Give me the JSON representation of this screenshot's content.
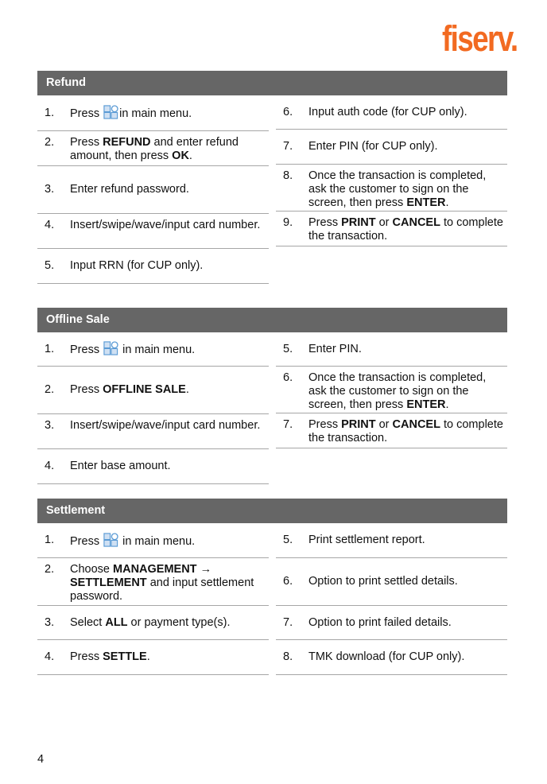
{
  "brand": {
    "logo_text": "fiserv.",
    "color": "#f26a21"
  },
  "header_color": "#666666",
  "sections": {
    "refund": {
      "title": "Refund",
      "left": [
        {
          "n": "1.",
          "parts": [
            [
              "Press ",
              false
            ],
            [
              "[menu-icon]",
              "icon"
            ],
            [
              "in main menu.",
              false
            ]
          ]
        },
        {
          "n": "2.",
          "parts": [
            [
              "Press ",
              false
            ],
            [
              "REFUND",
              true
            ],
            [
              " and enter refund amount, then press ",
              false
            ],
            [
              "OK",
              true
            ],
            [
              ".",
              false
            ]
          ]
        },
        {
          "n": "3.",
          "parts": [
            [
              "Enter refund password.",
              false
            ]
          ]
        },
        {
          "n": "4.",
          "parts": [
            [
              "Insert/swipe/wave/input card number.",
              false
            ]
          ]
        },
        {
          "n": "5.",
          "parts": [
            [
              "Input RRN (for CUP only).",
              false
            ]
          ]
        }
      ],
      "right": [
        {
          "n": "6.",
          "parts": [
            [
              "Input auth code (for CUP only).",
              false
            ]
          ]
        },
        {
          "n": "7.",
          "parts": [
            [
              "Enter PIN (for CUP only).",
              false
            ]
          ]
        },
        {
          "n": "8.",
          "parts": [
            [
              "Once the transaction is completed, ask the customer to sign on the screen, then press ",
              false
            ],
            [
              "ENTER",
              true
            ],
            [
              ".",
              false
            ]
          ]
        },
        {
          "n": "9.",
          "parts": [
            [
              "Press ",
              false
            ],
            [
              "PRINT",
              true
            ],
            [
              " or ",
              false
            ],
            [
              "CANCEL",
              true
            ],
            [
              " to complete the transaction.",
              false
            ]
          ]
        }
      ]
    },
    "offline_sale": {
      "title": "Offline Sale",
      "left": [
        {
          "n": "1.",
          "parts": [
            [
              "Press ",
              false
            ],
            [
              "[menu-icon]",
              "icon"
            ],
            [
              " in main menu.",
              false
            ]
          ]
        },
        {
          "n": "2.",
          "parts": [
            [
              "Press ",
              false
            ],
            [
              "OFFLINE SALE",
              true
            ],
            [
              ".",
              false
            ]
          ]
        },
        {
          "n": "3.",
          "parts": [
            [
              "Insert/swipe/wave/input card number.",
              false
            ]
          ]
        },
        {
          "n": "4.",
          "parts": [
            [
              "Enter base amount.",
              false
            ]
          ]
        }
      ],
      "right": [
        {
          "n": "5.",
          "parts": [
            [
              "Enter PIN.",
              false
            ]
          ]
        },
        {
          "n": "6.",
          "parts": [
            [
              "Once the transaction is completed, ask the customer to sign on the screen, then press ",
              false
            ],
            [
              "ENTER",
              true
            ],
            [
              ".",
              false
            ]
          ]
        },
        {
          "n": "7.",
          "parts": [
            [
              "Press ",
              false
            ],
            [
              "PRINT",
              true
            ],
            [
              " or ",
              false
            ],
            [
              "CANCEL",
              true
            ],
            [
              " to complete the transaction.",
              false
            ]
          ]
        }
      ]
    },
    "settlement": {
      "title": "Settlement",
      "left": [
        {
          "n": "1.",
          "parts": [
            [
              "Press ",
              false
            ],
            [
              "[menu-icon]",
              "icon"
            ],
            [
              " in main menu.",
              false
            ]
          ]
        },
        {
          "n": "2.",
          "parts": [
            [
              "Choose ",
              false
            ],
            [
              "MANAGEMENT",
              true
            ],
            [
              " → ",
              false
            ],
            [
              "SETTLEMENT",
              true
            ],
            [
              " and input settlement password.",
              false
            ]
          ]
        },
        {
          "n": "3.",
          "parts": [
            [
              "Select ",
              false
            ],
            [
              "ALL",
              true
            ],
            [
              " or payment type(s).",
              false
            ]
          ]
        },
        {
          "n": "4.",
          "parts": [
            [
              "Press ",
              false
            ],
            [
              "SETTLE",
              true
            ],
            [
              ".",
              false
            ]
          ]
        }
      ],
      "right": [
        {
          "n": "5.",
          "parts": [
            [
              "Print settlement report.",
              false
            ]
          ]
        },
        {
          "n": "6.",
          "parts": [
            [
              "Option to print settled details.",
              false
            ]
          ]
        },
        {
          "n": "7.",
          "parts": [
            [
              "Option to print failed details.",
              false
            ]
          ]
        },
        {
          "n": "8.",
          "parts": [
            [
              "TMK download (for CUP only).",
              false
            ]
          ]
        }
      ]
    }
  },
  "page_number": "4"
}
